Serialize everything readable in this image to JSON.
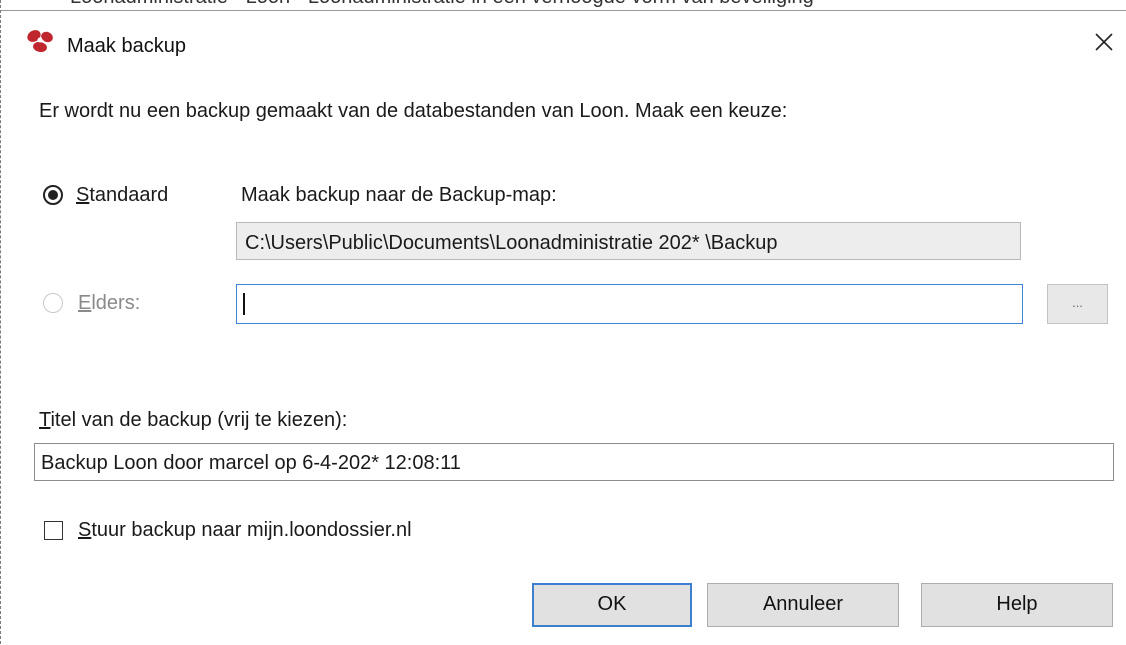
{
  "background": {
    "partial_text": "Loonadministratie - Loon - Loonadministratie in een verhoogde vorm van beveiliging"
  },
  "dialog": {
    "title": "Maak backup",
    "icons": {
      "app": "loon-app-icon",
      "close": "close-icon"
    },
    "intro": "Er wordt nu een backup gemaakt van de databestanden van Loon. Maak een keuze:",
    "standard": {
      "label": "Standaard",
      "selected": true,
      "folder_caption": "Maak backup naar de Backup-map:",
      "folder_path": "C:\\Users\\Public\\Documents\\Loonadministratie 202* \\Backup"
    },
    "elsewhere": {
      "label": "Elders:",
      "selected": false,
      "value": "",
      "browse_label": "..."
    },
    "backup_title": {
      "label": "Titel van de backup (vrij te kiezen):",
      "value": "Backup Loon door marcel op 6-4-202* 12:08:11"
    },
    "send_online": {
      "label": "Stuur backup naar mijn.loondossier.nl",
      "checked": false
    },
    "buttons": {
      "ok": "OK",
      "cancel": "Annuleer",
      "help": "Help"
    },
    "colors": {
      "focus_blue": "#3c7fd0",
      "icon_red": "#c0262d"
    }
  }
}
